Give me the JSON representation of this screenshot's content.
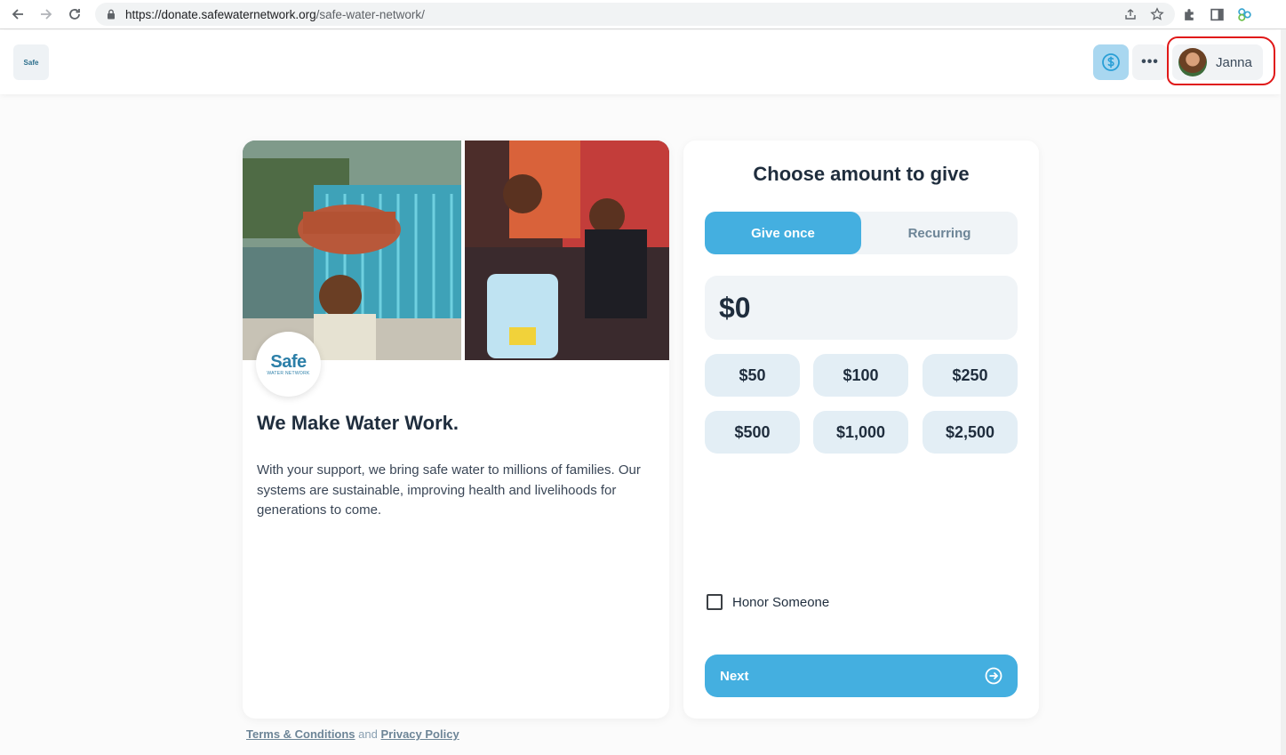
{
  "browser": {
    "url_host": "https://donate.safewaternetwork.org",
    "url_path": "/safe-water-network/"
  },
  "header": {
    "logo_text": "Safe",
    "user_name": "Janna"
  },
  "campaign": {
    "logo_word": "Safe",
    "logo_sub": "WATER NETWORK",
    "title": "We Make Water Work.",
    "description": "With your support, we bring safe water to millions of families. Our systems are sustainable, improving health and livelihoods for generations to come."
  },
  "form": {
    "title": "Choose amount to give",
    "frequency": [
      "Give once",
      "Recurring"
    ],
    "selected_frequency": "Give once",
    "amount_value": "$0",
    "presets": [
      "$50",
      "$100",
      "$250",
      "$500",
      "$1,000",
      "$2,500"
    ],
    "honor_label": "Honor Someone",
    "honor_checked": false,
    "next_label": "Next"
  },
  "footer": {
    "terms_label": "Terms & Conditions",
    "and_word": "and",
    "privacy_label": "Privacy Policy"
  },
  "colors": {
    "accent": "#44afe0",
    "annotation": "#e01818"
  }
}
